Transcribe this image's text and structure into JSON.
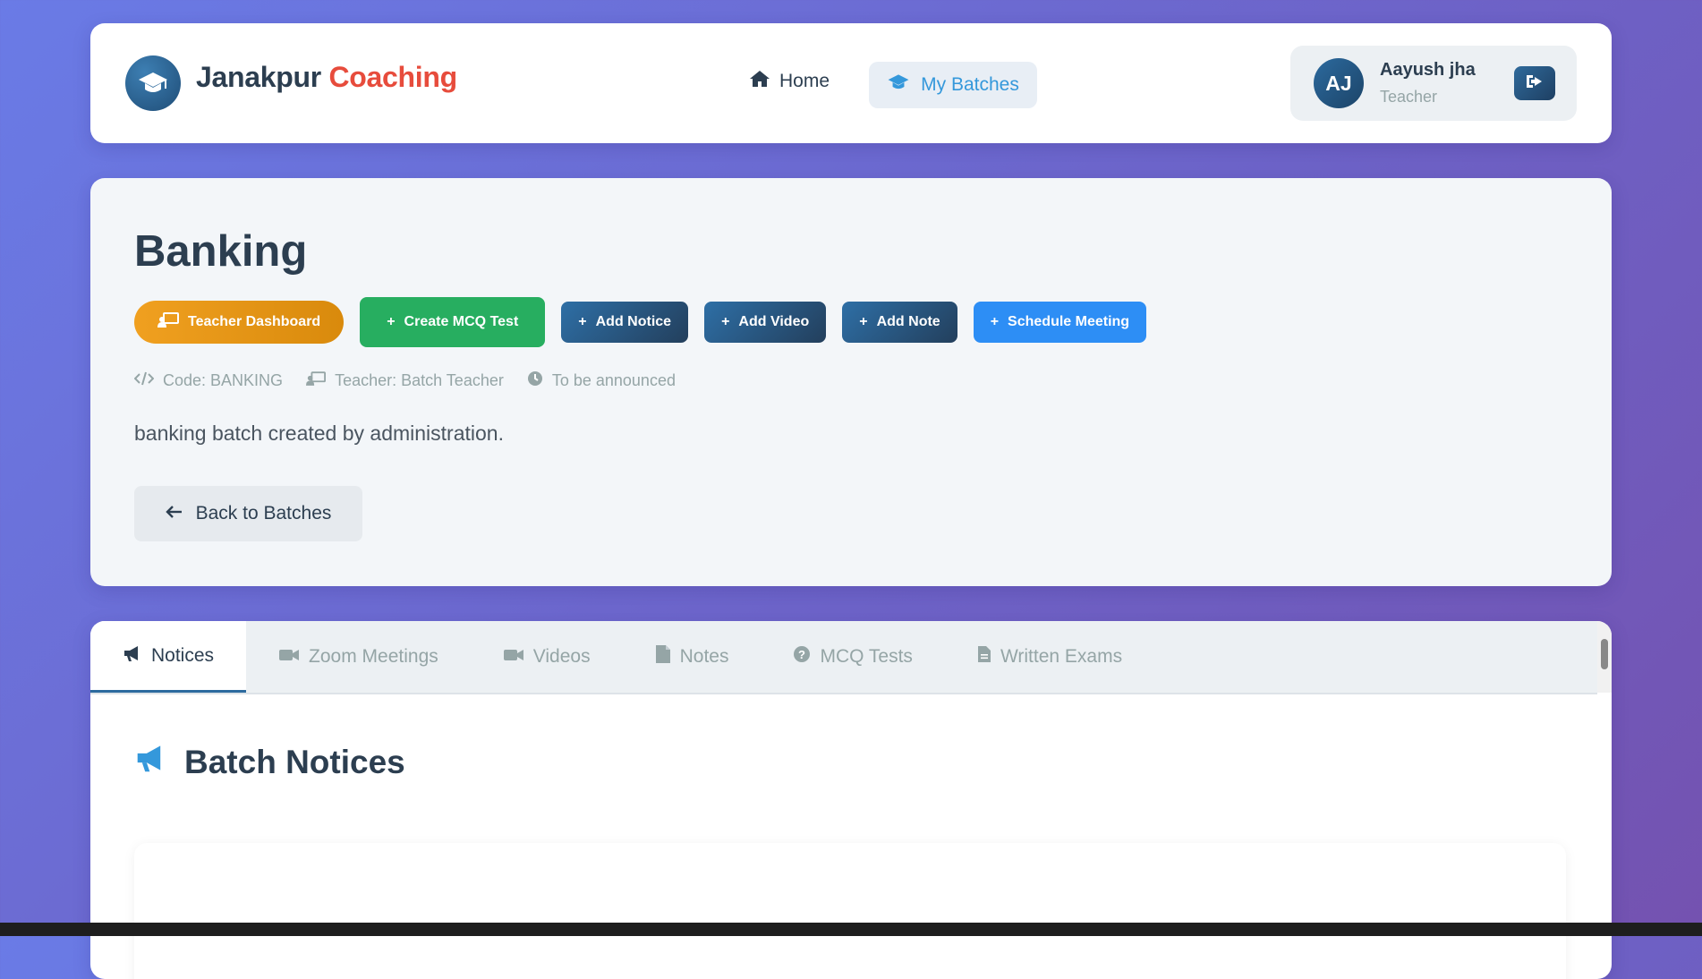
{
  "brand": {
    "name_part1": "Janakpur",
    "name_part2": "Coaching",
    "logo_icon": "graduation-cap-icon"
  },
  "nav": {
    "home_label": "Home",
    "batches_label": "My Batches"
  },
  "user": {
    "initials": "AJ",
    "name": "Aayush jha",
    "role": "Teacher",
    "logout_icon": "logout-icon"
  },
  "batch": {
    "title": "Banking",
    "buttons": {
      "teacher_dashboard": "Teacher Dashboard",
      "create_mcq": "Create MCQ Test",
      "add_notice": "Add Notice",
      "add_video": "Add Video",
      "add_note": "Add Note",
      "schedule_meeting": "Schedule Meeting"
    },
    "meta": {
      "code": "Code: BANKING",
      "teacher": "Teacher: Batch Teacher",
      "schedule": "To be announced"
    },
    "description": "banking batch created by administration.",
    "back_label": "Back to Batches"
  },
  "tabs": [
    {
      "label": "Notices",
      "icon": "megaphone-icon",
      "active": true
    },
    {
      "label": "Zoom Meetings",
      "icon": "video-camera-icon",
      "active": false
    },
    {
      "label": "Videos",
      "icon": "video-camera-icon",
      "active": false
    },
    {
      "label": "Notes",
      "icon": "pdf-file-icon",
      "active": false
    },
    {
      "label": "MCQ Tests",
      "icon": "question-circle-icon",
      "active": false
    },
    {
      "label": "Written Exams",
      "icon": "document-icon",
      "active": false
    }
  ],
  "section": {
    "title": "Batch Notices",
    "icon": "megaphone-icon"
  },
  "colors": {
    "accent_red": "#e74c3c",
    "primary_blue": "#3498db",
    "dark_navy": "#2c3e50",
    "green": "#27ae60",
    "orange": "#f0a020",
    "bright_blue": "#2d8ef5"
  }
}
